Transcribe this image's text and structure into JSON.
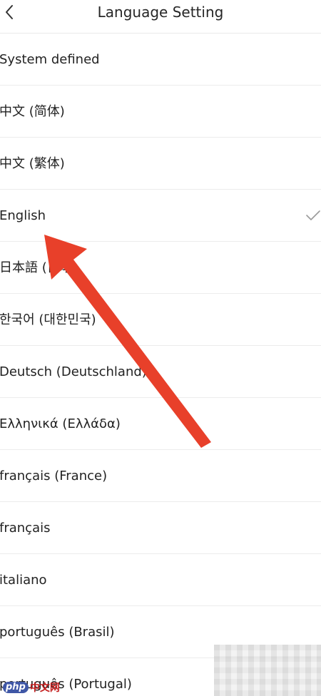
{
  "header": {
    "title": "Language Setting",
    "back_icon": "chevron-left-icon"
  },
  "languages": [
    {
      "label": "System defined",
      "selected": false
    },
    {
      "label": "中文 (简体)",
      "selected": false
    },
    {
      "label": "中文 (繁体)",
      "selected": false
    },
    {
      "label": "English",
      "selected": true
    },
    {
      "label": "日本語 (日本)",
      "selected": false
    },
    {
      "label": "한국어 (대한민국)",
      "selected": false
    },
    {
      "label": "Deutsch (Deutschland)",
      "selected": false
    },
    {
      "label": "Ελληνικά (Ελλάδα)",
      "selected": false
    },
    {
      "label": "français (France)",
      "selected": false
    },
    {
      "label": "français",
      "selected": false
    },
    {
      "label": "italiano",
      "selected": false
    },
    {
      "label": "português (Brasil)",
      "selected": false
    },
    {
      "label": "português (Portugal)",
      "selected": false
    }
  ],
  "check_icon": "checkmark-icon",
  "annotation": {
    "icon": "red-arrow-icon",
    "color": "#e8402a"
  },
  "watermark": {
    "badge": "php",
    "text": "中文网"
  },
  "colors": {
    "divider": "#ececec",
    "check": "#9a9a9a",
    "text": "#222222"
  }
}
